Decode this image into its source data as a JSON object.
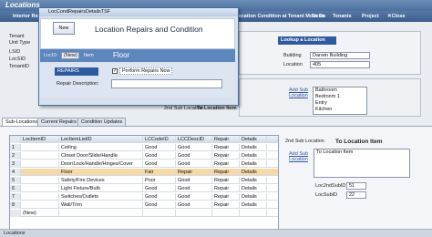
{
  "app": {
    "title": "Locations",
    "nav": [
      "Interior Repairs",
      "Location Condition at Tenant Move-in",
      "To Do",
      "Tenants",
      "Project",
      "Close"
    ]
  },
  "left_fields": {
    "labels": [
      "Tenant",
      "Unit Type",
      "LSID",
      "LocSID",
      "TenantID"
    ]
  },
  "dialog": {
    "title": "LocCondRepairsDetailsTSF",
    "new_label": "New",
    "heading": "Location Repairs and Condition",
    "item_label": "LocID",
    "item_value": "(New)",
    "item_field_label": "Item",
    "item_field_value": "Floor",
    "repairs_label": "REPAIRS",
    "perform_repairs_label": "Perform Repairs Now",
    "repair_desc_label": "Repair Description:"
  },
  "lookup": {
    "heading": "Lookup a Location",
    "building_label": "Building",
    "building_value": "Darwin Building",
    "location_label": "Location",
    "location_value": "405"
  },
  "sublocations_panel": {
    "add_label": "Add Sub Location",
    "items": [
      "Bathroom",
      "Bedroom 1",
      "Entry",
      "Kitchen"
    ],
    "second_label": "2nd Sub Location",
    "to_item_label": "To Location Item"
  },
  "tabs": [
    "Sub-Locations",
    "Current Repairs",
    "Condition Updates"
  ],
  "grid": {
    "columns": [
      "",
      "LocItemID",
      "LocItemListID",
      "LCCodeID",
      "LCCDescID",
      "Repair",
      "Details"
    ],
    "rows": [
      [
        "1",
        "",
        "Ceiling",
        "Good",
        "Good",
        "Repair",
        "Details"
      ],
      [
        "2",
        "",
        "Closet Door/Slide/Handle",
        "Good",
        "Good",
        "Repair",
        "Details"
      ],
      [
        "3",
        "",
        "Door/Lock/Handle/Hinges/Cover",
        "Good",
        "Good",
        "Repair",
        "Details"
      ],
      [
        "4",
        "",
        "Floor",
        "Fair",
        "Repair",
        "Repair",
        "Details"
      ],
      [
        "5",
        "",
        "Safety/Fire Devices",
        "Poor",
        "Good",
        "Repair",
        "Details"
      ],
      [
        "6",
        "",
        "Light Fixture/Bulb",
        "Good",
        "Good",
        "Repair",
        "Details"
      ],
      [
        "7",
        "",
        "Switches/Outlets",
        "Good",
        "Good",
        "Repair",
        "Details"
      ],
      [
        "8",
        "",
        "Wall/Trim",
        "Good",
        "Good",
        "Repair",
        "Details"
      ],
      [
        "",
        "(New)",
        "",
        "",
        "",
        "",
        ""
      ]
    ]
  },
  "right_lower": {
    "second_label": "2nd Sub Location",
    "to_item_heading": "To Location Item",
    "add_label": "Add Sub Location",
    "list": [
      "To Location Item"
    ],
    "loc2nd_label": "Loc2ndSubID",
    "loc2nd_value": "51",
    "locsub_label": "LocSubID",
    "locsub_value": "22"
  },
  "status": "Locations"
}
